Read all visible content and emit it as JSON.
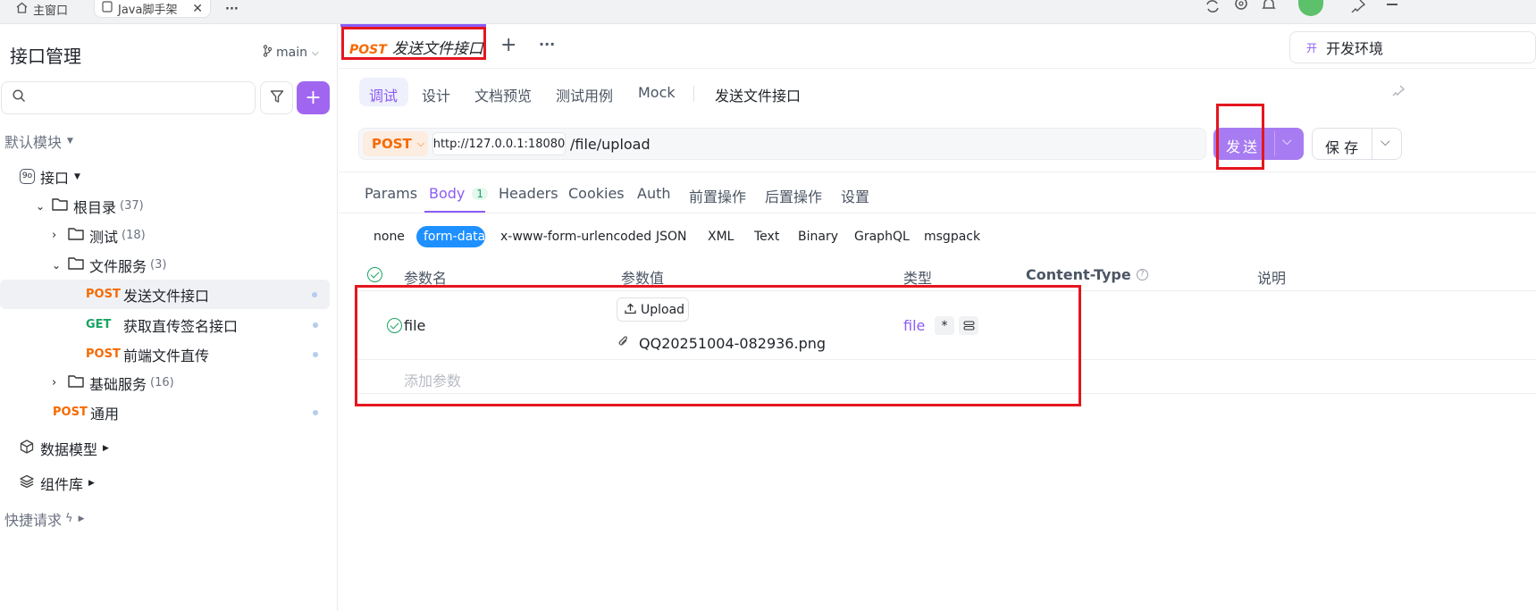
{
  "window": {
    "tabs": [
      {
        "label": "主窗口"
      },
      {
        "label": "Java脚手架"
      }
    ],
    "more": "···"
  },
  "sidebar": {
    "title": "接口管理",
    "branch": "main",
    "search_placeholder": "",
    "default_module": "默认模块",
    "api_label": "接口",
    "root": {
      "label": "根目录",
      "count": "(37)"
    },
    "folders": [
      {
        "label": "测试",
        "count": "(18)"
      },
      {
        "label": "文件服务",
        "count": "(3)"
      },
      {
        "label": "基础服务",
        "count": "(16)"
      }
    ],
    "endpoints": [
      {
        "method": "POST",
        "name": "发送文件接口"
      },
      {
        "method": "GET",
        "name": "获取直传签名接口"
      },
      {
        "method": "POST",
        "name": "前端文件直传"
      },
      {
        "method": "POST",
        "name": "通用"
      }
    ],
    "data_model": "数据模型",
    "components": "组件库",
    "quick_request": "快捷请求"
  },
  "doc_tab": {
    "method": "POST",
    "title": "发送文件接口",
    "add": "+",
    "more": "···"
  },
  "env": {
    "badge": "开",
    "label": "开发环境"
  },
  "mode_tabs": [
    {
      "label": "调试",
      "active": true
    },
    {
      "label": "设计"
    },
    {
      "label": "文档预览"
    },
    {
      "label": "测试用例"
    },
    {
      "label": "Mock"
    }
  ],
  "api_name": "发送文件接口",
  "request": {
    "method": "POST",
    "base_url": "http://127.0.0.1:18080",
    "path": "/file/upload",
    "send_label": "发送",
    "save_label": "保 存"
  },
  "req_tabs": [
    {
      "label": "Params"
    },
    {
      "label": "Body",
      "badge": "1",
      "active": true
    },
    {
      "label": "Headers"
    },
    {
      "label": "Cookies"
    },
    {
      "label": "Auth"
    },
    {
      "label": "前置操作"
    },
    {
      "label": "后置操作"
    },
    {
      "label": "设置"
    }
  ],
  "body_types": [
    "none",
    "form-data",
    "x-www-form-urlencoded",
    "JSON",
    "XML",
    "Text",
    "Binary",
    "GraphQL",
    "msgpack"
  ],
  "body_type_selected": "form-data",
  "table": {
    "headers": {
      "name": "参数名",
      "value": "参数值",
      "type": "类型",
      "content_type": "Content-Type",
      "desc": "说明"
    },
    "rows": [
      {
        "checked": true,
        "name": "file",
        "upload_label": "Upload",
        "file_name": "QQ20251004-082936.png",
        "type": "file",
        "required": "*"
      }
    ],
    "add_placeholder": "添加参数"
  },
  "colors": {
    "accent": "#8b5cf6",
    "post": "#f56a00",
    "get": "#19a463",
    "highlight": "#e5161e"
  }
}
